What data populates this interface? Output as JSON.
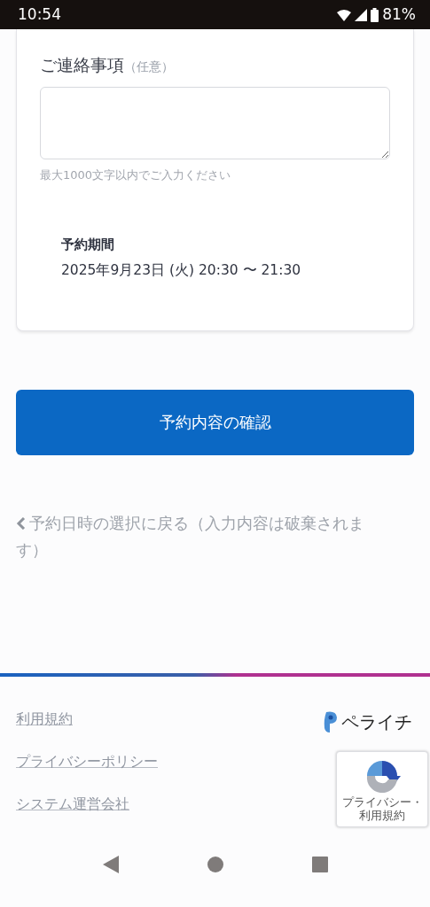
{
  "status_bar": {
    "time": "10:54",
    "battery": "81%"
  },
  "form": {
    "label": "ご連絡事項",
    "label_note": "（任意）",
    "hint": "最大1000文字以内でご入力ください"
  },
  "period": {
    "title": "予約期間",
    "value": "2025年9月23日 (火) 20:30 〜 21:30"
  },
  "confirm_button": "予約内容の確認",
  "back_link": "予約日時の選択に戻る（入力内容は破棄されます）",
  "footer": {
    "links": [
      "利用規約",
      "プライバシーポリシー",
      "システム運営会社"
    ],
    "logo": "ペライチ",
    "recaptcha": "プライバシー・利用規約"
  }
}
